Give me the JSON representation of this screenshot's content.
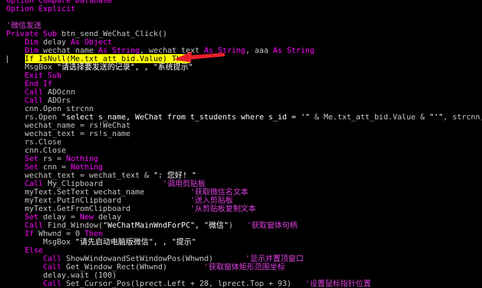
{
  "colors": {
    "background": "#000000",
    "keyword": "#ff00ff",
    "text": "#c8c8c8",
    "string": "#ffffff",
    "comment": "#e040e0",
    "highlight": "#ffff00",
    "arrow": "#e8202a"
  },
  "editor": {
    "lines": [
      {
        "indent": 0,
        "segs": [
          {
            "t": "Option Compare Database",
            "c": "k"
          }
        ]
      },
      {
        "indent": 0,
        "segs": [
          {
            "t": "Option Explicit",
            "c": "k"
          }
        ]
      },
      {
        "indent": 0,
        "segs": []
      },
      {
        "indent": 0,
        "segs": [
          {
            "t": "'微信发送",
            "c": "c"
          }
        ]
      },
      {
        "indent": 0,
        "segs": [
          {
            "t": "Private Sub ",
            "c": "k"
          },
          {
            "t": "btn_send_WeChat_Click()",
            "c": "n"
          }
        ]
      },
      {
        "indent": 4,
        "segs": [
          {
            "t": "Dim ",
            "c": "k"
          },
          {
            "t": "delay ",
            "c": "n"
          },
          {
            "t": "As Object",
            "c": "k"
          }
        ]
      },
      {
        "indent": 4,
        "segs": [
          {
            "t": "Dim ",
            "c": "k"
          },
          {
            "t": "wechat_name ",
            "c": "n"
          },
          {
            "t": "As String",
            "c": "k"
          },
          {
            "t": ", wechat_text ",
            "c": "n"
          },
          {
            "t": "As String",
            "c": "k"
          },
          {
            "t": ", aaa ",
            "c": "n"
          },
          {
            "t": "As String",
            "c": "k"
          }
        ]
      },
      {
        "indent": 4,
        "segs": [
          {
            "t": "If IsNull(Me.txt_att_bid.Value) Then",
            "c": "hl"
          }
        ]
      },
      {
        "indent": 4,
        "segs": [
          {
            "t": "MsgBox ",
            "c": "n"
          },
          {
            "t": "\"请选择要发送的记录\", , \"系统提示\"",
            "c": "s"
          }
        ]
      },
      {
        "indent": 4,
        "segs": [
          {
            "t": "Exit Sub",
            "c": "k"
          }
        ]
      },
      {
        "indent": 4,
        "segs": [
          {
            "t": "End If",
            "c": "k"
          }
        ]
      },
      {
        "indent": 4,
        "segs": [
          {
            "t": "Call ",
            "c": "k"
          },
          {
            "t": "ADOcnn",
            "c": "n"
          }
        ]
      },
      {
        "indent": 4,
        "segs": [
          {
            "t": "Call ",
            "c": "k"
          },
          {
            "t": "ADOrs",
            "c": "n"
          }
        ]
      },
      {
        "indent": 4,
        "segs": [
          {
            "t": "cnn.Open strcnn",
            "c": "n"
          }
        ]
      },
      {
        "indent": 4,
        "segs": [
          {
            "t": "rs.Open ",
            "c": "n"
          },
          {
            "t": "\"select s_name, WeChat from t_students where s_id = '\"",
            "c": "s"
          },
          {
            "t": " & Me.txt_att_bid.Value & ",
            "c": "n"
          },
          {
            "t": "\"'\"",
            "c": "s"
          },
          {
            "t": ", strcnn, 3, 3",
            "c": "n"
          }
        ]
      },
      {
        "indent": 4,
        "segs": [
          {
            "t": "wechat_name = rs!WeChat",
            "c": "n"
          }
        ]
      },
      {
        "indent": 4,
        "segs": [
          {
            "t": "wechat_text = rs!s_name",
            "c": "n"
          }
        ]
      },
      {
        "indent": 4,
        "segs": [
          {
            "t": "rs.Close",
            "c": "n"
          }
        ]
      },
      {
        "indent": 4,
        "segs": [
          {
            "t": "cnn.Close",
            "c": "n"
          }
        ]
      },
      {
        "indent": 4,
        "segs": [
          {
            "t": "Set ",
            "c": "k"
          },
          {
            "t": "rs = ",
            "c": "n"
          },
          {
            "t": "Nothing",
            "c": "k"
          }
        ]
      },
      {
        "indent": 4,
        "segs": [
          {
            "t": "Set ",
            "c": "k"
          },
          {
            "t": "cnn = ",
            "c": "n"
          },
          {
            "t": "Nothing",
            "c": "k"
          }
        ]
      },
      {
        "indent": 4,
        "segs": [
          {
            "t": "wechat_text = wechat_text & ",
            "c": "n"
          },
          {
            "t": "\": 您好! \"",
            "c": "s"
          }
        ]
      },
      {
        "indent": 4,
        "segs": [
          {
            "t": "Call ",
            "c": "k"
          },
          {
            "t": "My_Clipboard             ",
            "c": "n"
          },
          {
            "t": "'调用剪贴板",
            "c": "c"
          }
        ]
      },
      {
        "indent": 4,
        "segs": [
          {
            "t": "myText.SetText wechat_name          ",
            "c": "n"
          },
          {
            "t": "'获取微信名文本",
            "c": "c"
          }
        ]
      },
      {
        "indent": 4,
        "segs": [
          {
            "t": "myText.PutInClipboard               ",
            "c": "n"
          },
          {
            "t": "'送入剪贴板",
            "c": "c"
          }
        ]
      },
      {
        "indent": 4,
        "segs": [
          {
            "t": "myText.GetFromClipboard             ",
            "c": "n"
          },
          {
            "t": "'从剪贴板复制文本",
            "c": "c"
          }
        ]
      },
      {
        "indent": 4,
        "segs": [
          {
            "t": "Set ",
            "c": "k"
          },
          {
            "t": "delay = ",
            "c": "n"
          },
          {
            "t": "New ",
            "c": "k"
          },
          {
            "t": "delay",
            "c": "n"
          }
        ]
      },
      {
        "indent": 4,
        "segs": [
          {
            "t": "Call ",
            "c": "k"
          },
          {
            "t": "Find_Window(",
            "c": "n"
          },
          {
            "t": "\"WeChatMainWndForPC\", \"微信\"",
            "c": "s"
          },
          {
            "t": ")   ",
            "c": "n"
          },
          {
            "t": "'获取窗体句柄",
            "c": "c"
          }
        ]
      },
      {
        "indent": 4,
        "segs": [
          {
            "t": "If ",
            "c": "k"
          },
          {
            "t": "Whwnd = 0 ",
            "c": "n"
          },
          {
            "t": "Then",
            "c": "k"
          }
        ]
      },
      {
        "indent": 8,
        "segs": [
          {
            "t": "MsgBox ",
            "c": "n"
          },
          {
            "t": "\"请先启动电脑版微信\", , \"提示\"",
            "c": "s"
          }
        ]
      },
      {
        "indent": 4,
        "segs": [
          {
            "t": "Else",
            "c": "k"
          }
        ]
      },
      {
        "indent": 8,
        "segs": [
          {
            "t": "Call ",
            "c": "k"
          },
          {
            "t": "ShowWindowandSetWindowPos(Whwnd)       ",
            "c": "n"
          },
          {
            "t": "'显示并置顶窗口",
            "c": "c"
          }
        ]
      },
      {
        "indent": 8,
        "segs": [
          {
            "t": "Call ",
            "c": "k"
          },
          {
            "t": "Get_Window_Rect(Whwnd)        ",
            "c": "n"
          },
          {
            "t": "'获取窗体矩形范围坐标",
            "c": "c"
          }
        ]
      },
      {
        "indent": 8,
        "segs": [
          {
            "t": "delay.wait (100)",
            "c": "n"
          }
        ]
      },
      {
        "indent": 8,
        "segs": [
          {
            "t": "Call ",
            "c": "k"
          },
          {
            "t": "Set_Cursor_Pos(lprect.Left + 28, lprect.Top + 93)   ",
            "c": "n"
          },
          {
            "t": "'设置鼠标指针位置",
            "c": "c"
          }
        ]
      }
    ]
  }
}
